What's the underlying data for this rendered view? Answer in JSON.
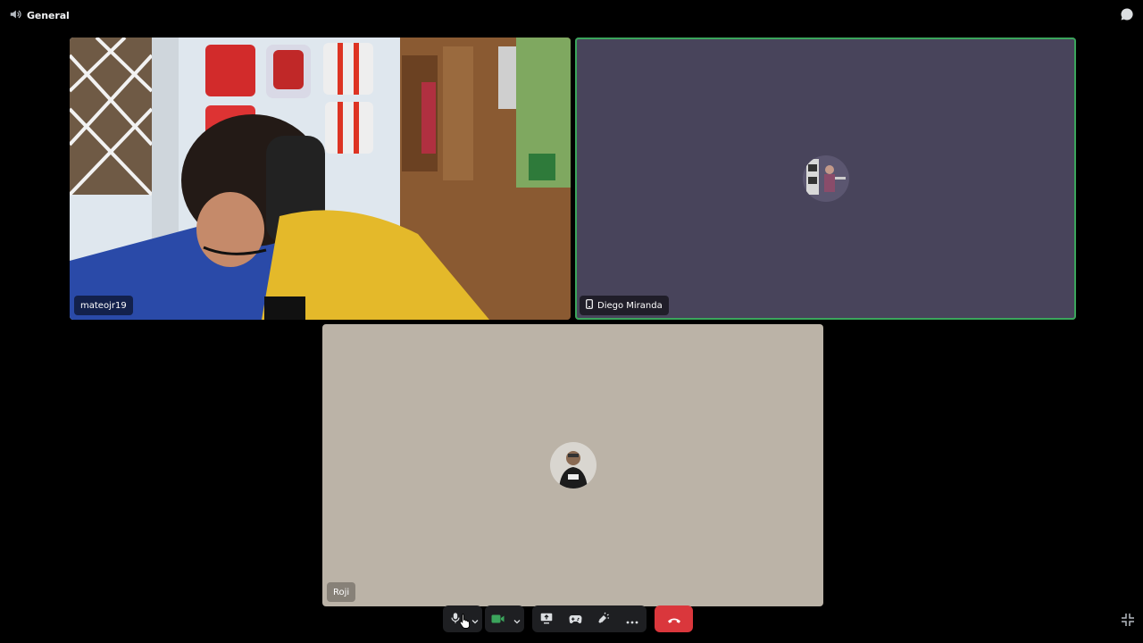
{
  "topbar": {
    "channel_name": "General",
    "channel_icon": "speaker-icon",
    "chat_icon": "chat-bubble-icon"
  },
  "tiles": [
    {
      "name": "mateojr19",
      "type": "camera-video"
    },
    {
      "name": "Diego Miranda",
      "type": "avatar",
      "device_icon": "mobile-phone-icon",
      "speaking": true
    },
    {
      "name": "Roji",
      "type": "avatar"
    }
  ],
  "controls": {
    "mic_icon": "microphone-icon",
    "camera_icon": "video-camera-icon",
    "share_icon": "screen-share-icon",
    "activity_icon": "gamepad-icon",
    "soundboard_icon": "soundboard-icon",
    "more_icon": "more-dots-icon",
    "disconnect_icon": "hang-up-icon",
    "fullscreen_icon": "exit-fullscreen-icon"
  },
  "colors": {
    "background": "#000000",
    "speaking_border": "#3ba55c",
    "disconnect": "#da373c",
    "camera_active": "#3ba55c",
    "tile_2_bg": "#48445b",
    "tile_3_bg": "#bbb3a7"
  }
}
